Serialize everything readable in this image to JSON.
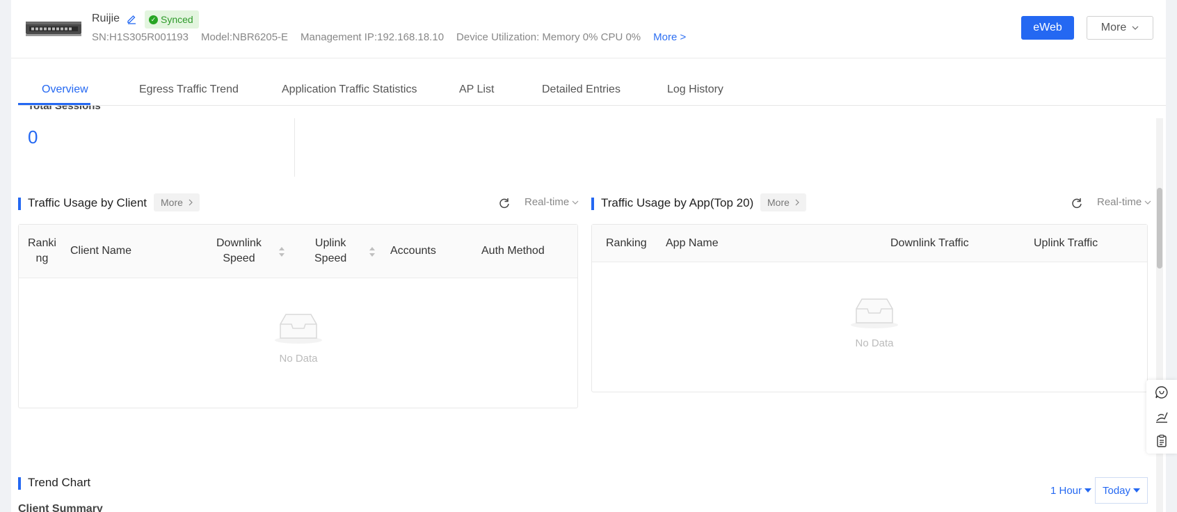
{
  "device": {
    "name": "Ruijie",
    "status": "Synced",
    "sn": "SN:H1S305R001193",
    "model": "Model:NBR6205-E",
    "ip": "Management IP:192.168.18.10",
    "utilization": "Device Utilization: Memory 0% CPU 0%",
    "more_link": "More >"
  },
  "header_actions": {
    "eweb": "eWeb",
    "more": "More"
  },
  "tabs": [
    {
      "label": "Overview"
    },
    {
      "label": "Egress Traffic Trend"
    },
    {
      "label": "Application Traffic Statistics"
    },
    {
      "label": "AP List"
    },
    {
      "label": "Detailed Entries"
    },
    {
      "label": "Log History"
    }
  ],
  "sessions": {
    "label": "Total Sessions",
    "value": "0"
  },
  "client_traffic": {
    "title": "Traffic Usage by Client",
    "more": "More",
    "range": "Real-time",
    "columns": {
      "ranking_a": "Ranki",
      "ranking_b": "ng",
      "client_name": "Client Name",
      "downlink_a": "Downlink",
      "downlink_b": "Speed",
      "uplink_a": "Uplink",
      "uplink_b": "Speed",
      "accounts": "Accounts",
      "auth_method": "Auth Method"
    },
    "empty": "No Data"
  },
  "app_traffic": {
    "title": "Traffic Usage by App(Top 20)",
    "more": "More",
    "range": "Real-time",
    "columns": {
      "ranking": "Ranking",
      "app_name": "App Name",
      "downlink": "Downlink Traffic",
      "uplink": "Uplink Traffic"
    },
    "empty": "No Data"
  },
  "trend": {
    "title": "Trend Chart",
    "subtitle": "Client Summary",
    "interval": "1 Hour",
    "date": "Today"
  },
  "colors": {
    "accent": "#2468f2",
    "synced_green": "#27a523"
  }
}
